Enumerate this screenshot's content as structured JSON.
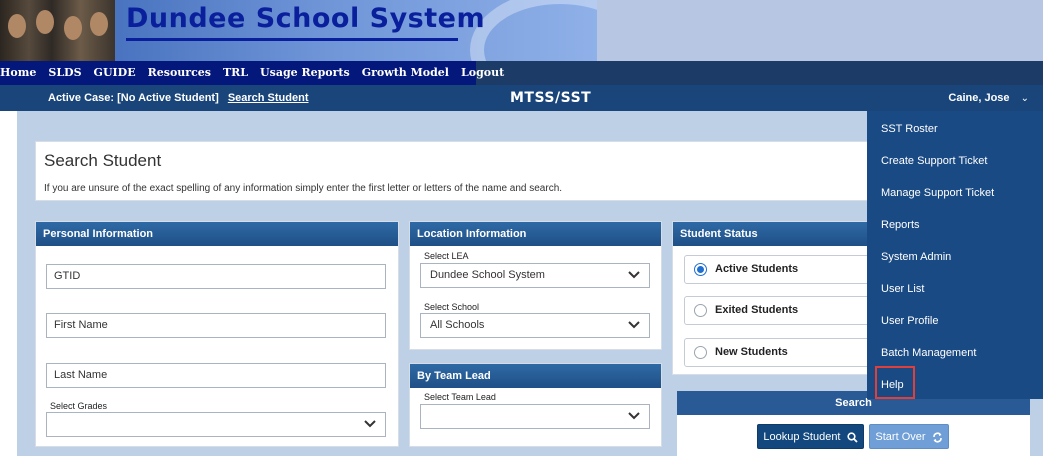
{
  "banner": {
    "title": "Dundee School System"
  },
  "nav": {
    "items": [
      "Home",
      "SLDS",
      "GUIDE",
      "Resources",
      "TRL",
      "Usage Reports",
      "Growth Model",
      "Logout"
    ]
  },
  "casebar": {
    "active_case": "Active Case: [No Active Student]",
    "search_link": "Search Student",
    "module": "MTSS/SST",
    "user": "Caine, Jose"
  },
  "search_header": {
    "title": "Search Student",
    "hint": "If you are unsure of the exact spelling of any information simply enter the first letter or letters of the name and search."
  },
  "personal": {
    "heading": "Personal Information",
    "gtid": "GTID",
    "first_name": "First Name",
    "last_name": "Last Name",
    "grades_label": "Select Grades",
    "grades_value": ""
  },
  "location": {
    "heading": "Location Information",
    "lea_label": "Select LEA",
    "lea_value": "Dundee School System",
    "school_label": "Select School",
    "school_value": "All Schools"
  },
  "team_lead": {
    "heading": "By Team Lead",
    "label": "Select Team Lead",
    "value": ""
  },
  "status": {
    "heading": "Student Status",
    "options": [
      "Active Students",
      "Exited Students",
      "New Students"
    ],
    "selected": "Active Students"
  },
  "search_panel": {
    "heading": "Search",
    "lookup_label": "Lookup Student",
    "startover_label": "Start Over"
  },
  "user_menu": {
    "items": [
      "SST Roster",
      "Create Support Ticket",
      "Manage Support Ticket",
      "Reports",
      "System Admin",
      "User List",
      "User Profile",
      "Batch Management",
      "Help"
    ],
    "highlighted": "Help"
  },
  "colors": {
    "banner_title": "#0a1f9c",
    "nav_bg": "#04177a",
    "casebar_bg": "#19457a",
    "panel_head": "#1f4f86",
    "menu_bg": "#1a4a84",
    "highlight": "#e0403c"
  }
}
